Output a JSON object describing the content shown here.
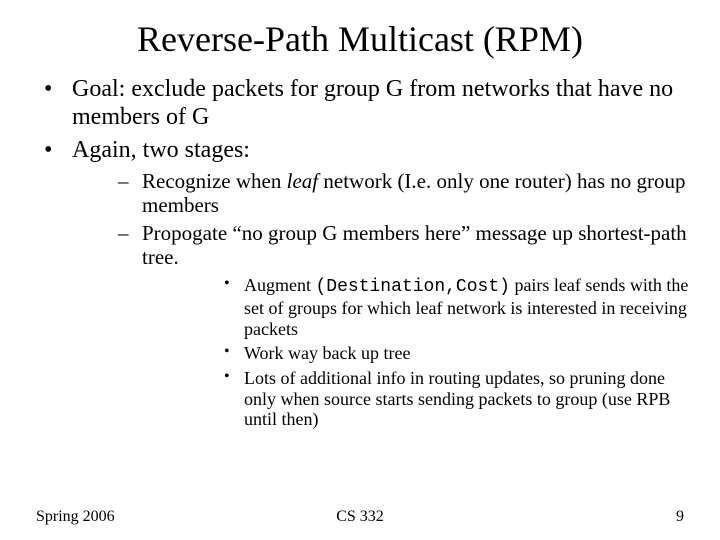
{
  "title": "Reverse-Path Multicast (RPM)",
  "bullets": {
    "b1": "Goal: exclude packets for group G from networks that have no members of G",
    "b2": "Again, two stages:",
    "s1_a": "Recognize when ",
    "s1_leaf": "leaf",
    "s1_b": " network (I.e. only one router) has no group members",
    "s2": "Propogate “no group G members here” message up shortest-path tree.",
    "t1_a": "Augment ",
    "t1_code": "(Destination,Cost)",
    "t1_b": " pairs leaf sends with the set of groups for which leaf network is interested in receiving packets",
    "t2": "Work way back up tree",
    "t3": "Lots of additional info in routing updates, so pruning done only when source starts sending packets to group (use RPB until then)"
  },
  "footer": {
    "left": "Spring 2006",
    "center": "CS 332",
    "right": "9"
  }
}
